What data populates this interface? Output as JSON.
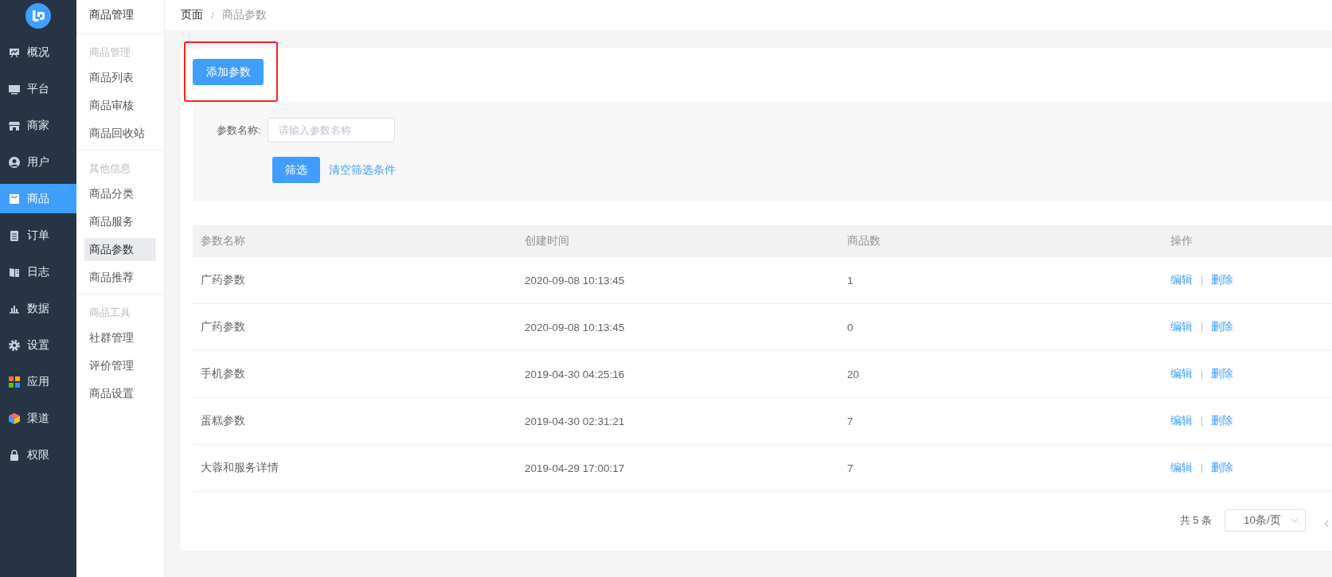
{
  "main_nav": [
    {
      "label": "概况",
      "selected": false
    },
    {
      "label": "平台",
      "selected": false
    },
    {
      "label": "商家",
      "selected": false
    },
    {
      "label": "用户",
      "selected": false
    },
    {
      "label": "商品",
      "selected": true
    },
    {
      "label": "订单",
      "selected": false
    },
    {
      "label": "日志",
      "selected": false
    },
    {
      "label": "数据",
      "selected": false
    },
    {
      "label": "设置",
      "selected": false
    },
    {
      "label": "应用",
      "selected": false
    },
    {
      "label": "渠道",
      "selected": false
    },
    {
      "label": "权限",
      "selected": false
    }
  ],
  "sub_nav": {
    "title": "商品管理",
    "groups": [
      {
        "heading": "商品管理",
        "items": [
          {
            "label": "商品列表",
            "selected": false
          },
          {
            "label": "商品审核",
            "selected": false
          },
          {
            "label": "商品回收站",
            "selected": false
          }
        ]
      },
      {
        "heading": "其他信息",
        "items": [
          {
            "label": "商品分类",
            "selected": false
          },
          {
            "label": "商品服务",
            "selected": false
          },
          {
            "label": "商品参数",
            "selected": true
          },
          {
            "label": "商品推荐",
            "selected": false
          }
        ]
      },
      {
        "heading": "商品工具",
        "items": [
          {
            "label": "社群管理",
            "selected": false
          },
          {
            "label": "评价管理",
            "selected": false
          },
          {
            "label": "商品设置",
            "selected": false
          }
        ]
      }
    ]
  },
  "breadcrumb": {
    "items": [
      "页面",
      "商品参数"
    ],
    "separator": "/"
  },
  "add_button": "添加参数",
  "filter": {
    "label": "参数名称:",
    "placeholder": "请输入参数名称",
    "submit": "筛选",
    "clear": "清空筛选条件"
  },
  "table": {
    "columns": [
      "参数名称",
      "创建时间",
      "商品数",
      "操作"
    ],
    "rows": [
      {
        "name": "广药参数",
        "created": "2020-09-08 10:13:45",
        "count": "1",
        "actions": [
          "编辑",
          "删除"
        ]
      },
      {
        "name": "广药参数",
        "created": "2020-09-08 10:13:45",
        "count": "0",
        "actions": [
          "编辑",
          "删除"
        ]
      },
      {
        "name": "手机参数",
        "created": "2019-04-30 04:25:16",
        "count": "20",
        "actions": [
          "编辑",
          "删除"
        ]
      },
      {
        "name": "蛋糕参数",
        "created": "2019-04-30 02:31:21",
        "count": "7",
        "actions": [
          "编辑",
          "删除"
        ]
      },
      {
        "name": "大蓉和服务详情",
        "created": "2019-04-29 17:00:17",
        "count": "7",
        "actions": [
          "编辑",
          "删除"
        ]
      }
    ]
  },
  "pagination": {
    "total": "共 5 条",
    "page_size": "10条/页",
    "prev": "‹"
  }
}
